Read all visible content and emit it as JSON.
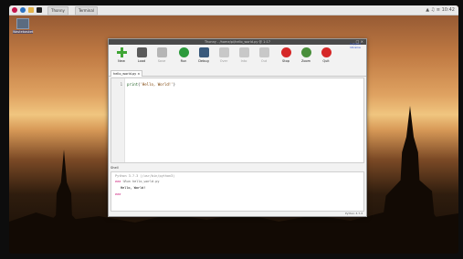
{
  "taskbar": {
    "task_labels": [
      "Thonny",
      "Terminal"
    ],
    "tray_text": "▲ ♫ ≡ 10:42"
  },
  "desktop": {
    "icon_label": "Wastebasket"
  },
  "window": {
    "title": "Thonny - /home/pi/hello_world.py @ 1:17",
    "controls": "_ □ ×",
    "support_text": "Support Ukraine",
    "toolbar": [
      {
        "name": "new-button",
        "icon": "new-icon",
        "label": "New",
        "enabled": true,
        "color": "#3fa535"
      },
      {
        "name": "load-button",
        "icon": "load-icon",
        "label": "Load",
        "enabled": true,
        "color": "#5a5a5a"
      },
      {
        "name": "save-button",
        "icon": "save-icon",
        "label": "Save",
        "enabled": false,
        "color": "#b5b5b5"
      },
      {
        "name": "run-button",
        "icon": "run-icon",
        "label": "Run",
        "enabled": true,
        "color": "#2c9a3c"
      },
      {
        "name": "debug-button",
        "icon": "debug-icon",
        "label": "Debug",
        "enabled": true,
        "color": "#3a5a7c"
      },
      {
        "name": "over-button",
        "icon": "over-icon",
        "label": "Over",
        "enabled": false,
        "color": "#c8c8c8"
      },
      {
        "name": "into-button",
        "icon": "into-icon",
        "label": "Into",
        "enabled": false,
        "color": "#c8c8c8"
      },
      {
        "name": "out-button",
        "icon": "out-icon",
        "label": "Out",
        "enabled": false,
        "color": "#c8c8c8"
      },
      {
        "name": "stop-button",
        "icon": "stop-icon",
        "label": "Stop",
        "enabled": true,
        "color": "#d62828"
      },
      {
        "name": "zoom-button",
        "icon": "zoom-icon",
        "label": "Zoom",
        "enabled": true,
        "color": "#4a8f3c"
      },
      {
        "name": "quit-button",
        "icon": "quit-icon",
        "label": "Quit",
        "enabled": true,
        "color": "#d62828"
      }
    ],
    "tab_label": "hello_world.py ×",
    "editor": {
      "line_number": "1",
      "code_kw": "print",
      "code_rest": "(",
      "code_str": "'Hello, World!'",
      "code_end": ")"
    },
    "shell_title": "Shell",
    "shell": {
      "version_line": "Python 3.7.3 (/usr/bin/python3)",
      "prompt": ">>>",
      "run_command": "%Run hello_world.py",
      "output": "Hello, World!"
    },
    "status": "Python 3.7.3"
  }
}
